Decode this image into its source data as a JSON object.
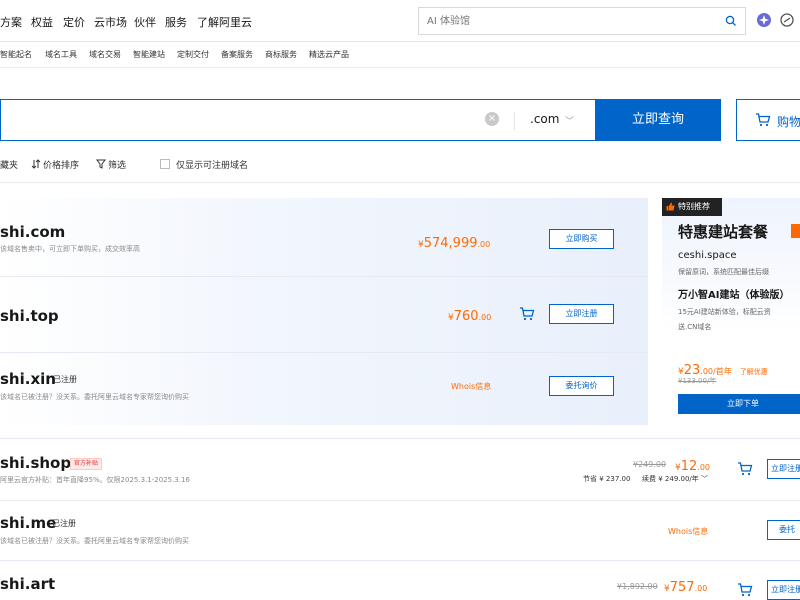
{
  "nav": {
    "items": [
      "方案",
      "权益",
      "定价",
      "云市场",
      "伙伴",
      "服务",
      "了解阿里云"
    ],
    "search_placeholder": "AI 体验馆"
  },
  "subnav": {
    "items": [
      "智能起名",
      "域名工具",
      "域名交易",
      "智能建站",
      "定制交付",
      "备案服务",
      "商标服务",
      "精选云产品"
    ]
  },
  "domain_search": {
    "value": "",
    "tld": ".com",
    "query_label": "立即查询",
    "cart_label": "购物"
  },
  "filters": {
    "favorites": "藏夹",
    "price_sort": "价格排序",
    "filter": "筛选",
    "only_available": "仅显示可注册域名"
  },
  "results": [
    {
      "name": "shi.com",
      "note": "该域名售卖中，可立即下单购买，成交效率高",
      "price_currency": "¥",
      "price_int": "574,999",
      "price_dec": ".00",
      "action": "立即购买"
    },
    {
      "name": "shi.top",
      "price_currency": "¥",
      "price_int": "760",
      "price_dec": ".00",
      "action": "立即注册"
    },
    {
      "name": "shi.xin",
      "status": "已注册",
      "note": "该域名已被注册？没关系。委托阿里云域名专家帮您询价购买",
      "whois": "Whois信息",
      "action": "委托询价"
    },
    {
      "name": "shi.shop",
      "badge": "官方补贴",
      "note": "阿里云官方补贴：首年直降95%。仅限2025.3.1-2025.3.16",
      "old_price": "¥249.00",
      "price_currency": "¥",
      "price_int": "12",
      "price_dec": ".00",
      "save_label": "节省",
      "save_value": "¥ 237.00",
      "renew_label": "续费",
      "renew_value": "¥ 249.00/年",
      "action": "立即注册"
    },
    {
      "name": "shi.me",
      "status": "已注册",
      "note": "该域名已被注册？没关系。委托阿里云域名专家帮您询价购买",
      "whois": "Whois信息",
      "action": "委托"
    },
    {
      "name": "shi.art",
      "old_price": "¥1,892.00",
      "price_currency": "¥",
      "price_int": "757",
      "price_dec": ".00",
      "action": "立即注册"
    }
  ],
  "ad": {
    "badge": "特别推荐",
    "title": "特惠建站套餐",
    "corner": "",
    "domain": "ceshi.space",
    "desc1": "保留原词，系统匹配最佳后缀",
    "subtitle": "万小智AI建站（体验版）",
    "desc2": "15元AI建站新体验，标配云资",
    "desc3": "送.CN域名",
    "price_currency": "¥",
    "price_int": "23",
    "price_unit": ".00/首年",
    "learn_more": "了解优惠",
    "old_price": "¥133.00/年",
    "button": "立即下单"
  },
  "colors": {
    "brand": "#0064c8",
    "price": "#ff6a00"
  }
}
